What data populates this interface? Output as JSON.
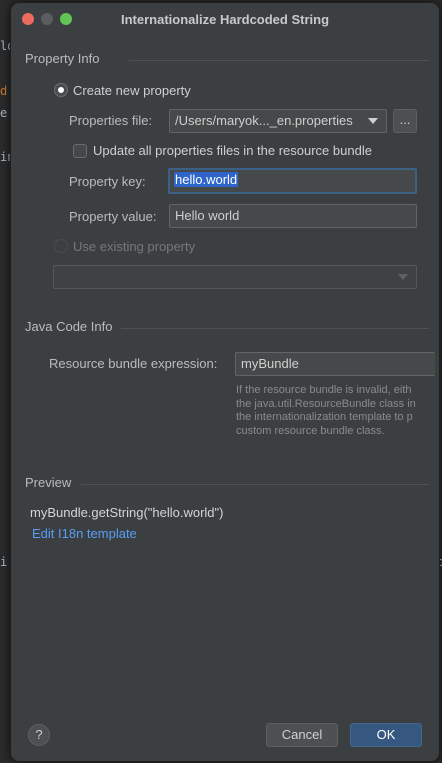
{
  "editor_background": {
    "fragments": [
      "ld",
      "d",
      "e",
      "in",
      "i",
      "c"
    ]
  },
  "dialog": {
    "title": "Internationalize Hardcoded String",
    "property_info": {
      "section_title": "Property Info",
      "create_new_label": "Create new property",
      "create_new_selected": true,
      "properties_file_label": "Properties file:",
      "properties_file_value": "/Users/maryok..._en.properties",
      "browse_label": "...",
      "update_all_label": "Update all properties files in the resource bundle",
      "update_all_checked": false,
      "property_key_label": "Property key:",
      "property_key_value": "hello.world",
      "property_value_label": "Property value:",
      "property_value_value": "Hello world",
      "use_existing_label": "Use existing property",
      "use_existing_selected": false,
      "existing_property_value": ""
    },
    "java_code_info": {
      "section_title": "Java Code Info",
      "bundle_expression_label": "Resource bundle expression:",
      "bundle_expression_value": "myBundle",
      "help_lines": [
        "If the resource bundle is invalid, eith",
        "the java.util.ResourceBundle class in",
        "the internationalization template to p",
        "custom resource bundle class."
      ]
    },
    "preview": {
      "section_title": "Preview",
      "code": "myBundle.getString(\"hello.world\")",
      "edit_template_link": "Edit I18n template"
    },
    "footer": {
      "help_label": "?",
      "cancel_label": "Cancel",
      "ok_label": "OK"
    }
  },
  "colors": {
    "dialog_bg": "#3c3f41",
    "accent": "#365880",
    "link": "#589df6",
    "selection": "#2f65ca",
    "focus_border": "#3d6185"
  }
}
